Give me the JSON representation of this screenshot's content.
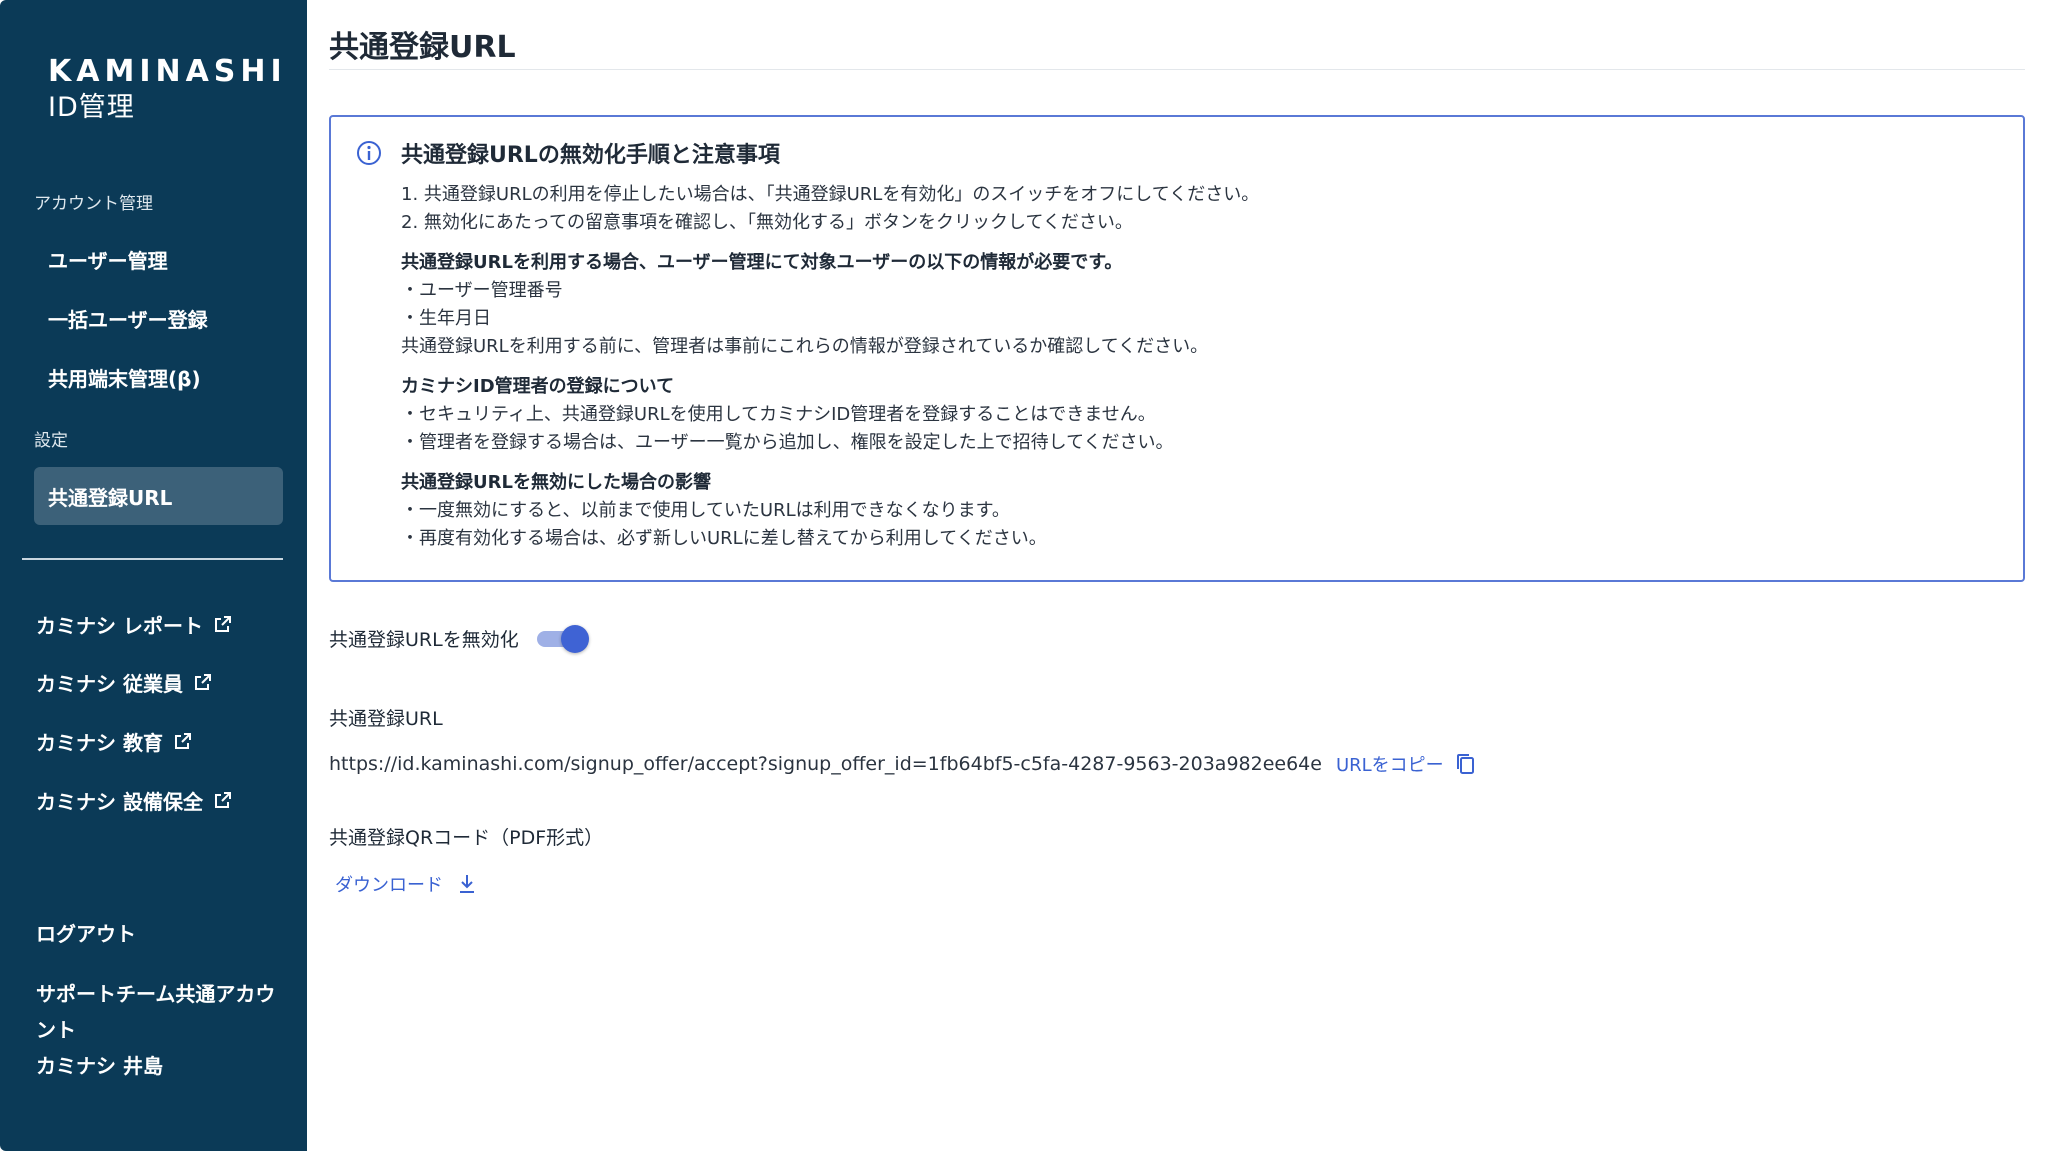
{
  "sidebar": {
    "brand": "KAMINASHI",
    "brand_sub": "ID管理",
    "section_account": "アカウント管理",
    "nav_users": "ユーザー管理",
    "nav_bulk": "一括ユーザー登録",
    "nav_devices": "共用端末管理(β)",
    "section_settings": "設定",
    "nav_signup_url": "共通登録URL",
    "ext_report": "カミナシ レポート",
    "ext_employee": "カミナシ 従業員",
    "ext_education": "カミナシ 教育",
    "ext_maintenance": "カミナシ 設備保全",
    "logout": "ログアウト",
    "account_name": "サポートチーム共通アカウント",
    "account_user": "カミナシ 井島"
  },
  "main": {
    "title": "共通登録URL",
    "notice": {
      "heading": "共通登録URLの無効化手順と注意事項",
      "step1": "1. 共通登録URLの利用を停止したい場合は、「共通登録URLを有効化」のスイッチをオフにしてください。",
      "step2": "2. 無効化にあたっての留意事項を確認し、「無効化する」ボタンをクリックしてください。",
      "sub1": "共通登録URLを利用する場合、ユーザー管理にて対象ユーザーの以下の情報が必要です。",
      "sub1_a": "・ユーザー管理番号",
      "sub1_b": "・生年月日",
      "sub1_c": "共通登録URLを利用する前に、管理者は事前にこれらの情報が登録されているか確認してください。",
      "sub2": "カミナシID管理者の登録について",
      "sub2_a": "・セキュリティ上、共通登録URLを使用してカミナシID管理者を登録することはできません。",
      "sub2_b": "・管理者を登録する場合は、ユーザー一覧から追加し、権限を設定した上で招待してください。",
      "sub3": "共通登録URLを無効にした場合の影響",
      "sub3_a": "・一度無効にすると、以前まで使用していたURLは利用できなくなります。",
      "sub3_b": "・再度有効化する場合は、必ず新しいURLに差し替えてから利用してください。"
    },
    "toggle_label": "共通登録URLを無効化",
    "toggle_on": true,
    "url_label": "共通登録URL",
    "url_value": "https://id.kaminashi.com/signup_offer/accept?signup_offer_id=1fb64bf5-c5fa-4287-9563-203a982ee64e",
    "copy_label": "URLをコピー",
    "qr_label": "共通登録QRコード（PDF形式）",
    "download_label": "ダウンロード"
  },
  "colors": {
    "sidebar_bg": "#0b3a57",
    "sidebar_active": "#3c6179",
    "accent": "#3a62d2",
    "notice_border": "#5a79d6"
  }
}
